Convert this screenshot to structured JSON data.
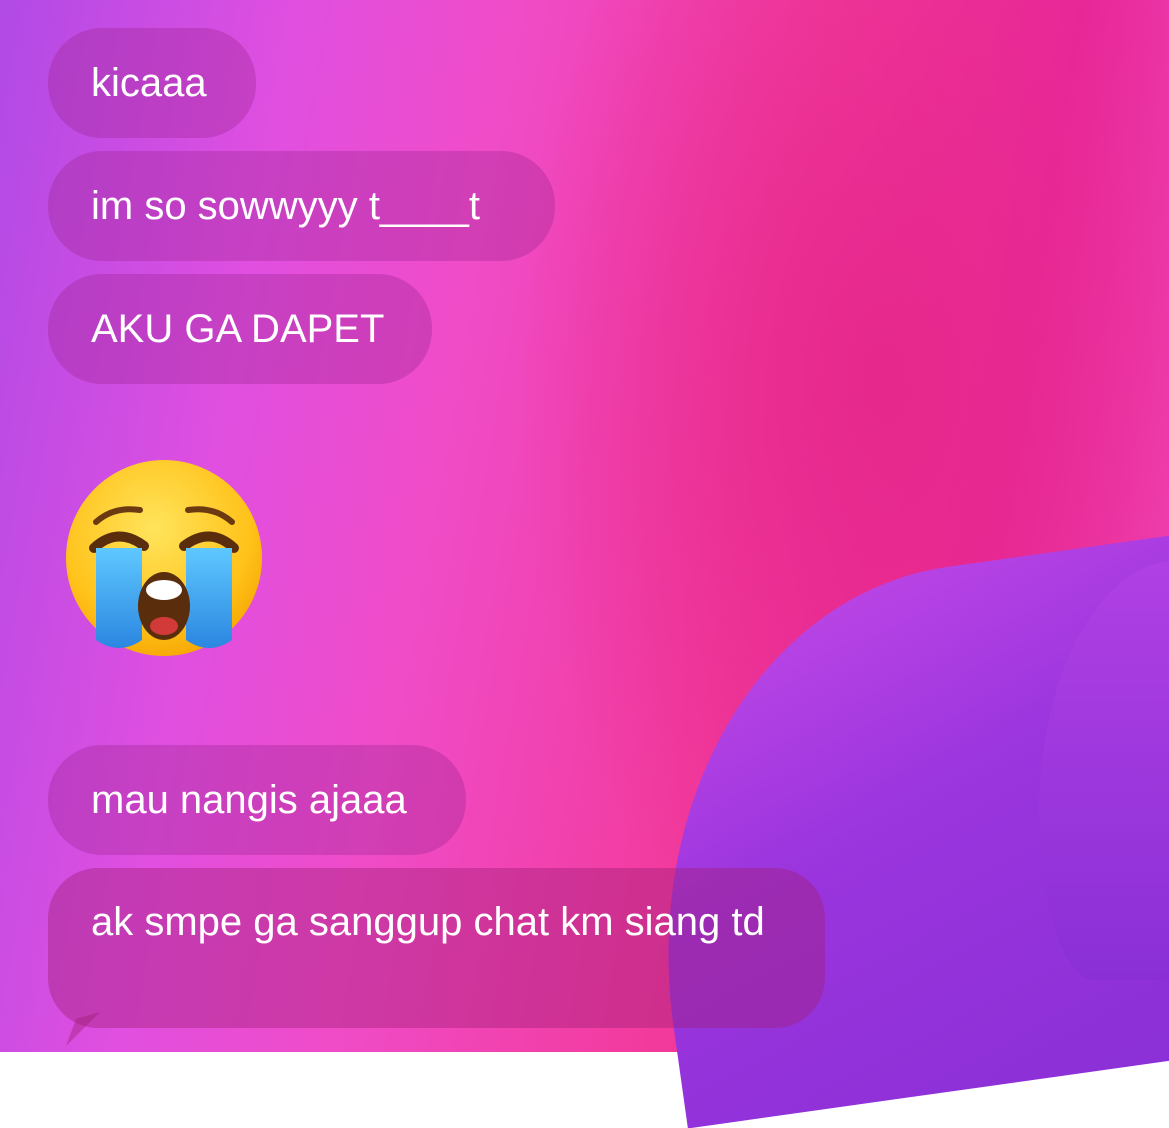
{
  "messages": [
    {
      "text": "kicaaa"
    },
    {
      "text": "im so sowwyyy t____t"
    },
    {
      "text": "AKU GA DAPET"
    },
    {
      "emoji": "loudly-crying-face"
    },
    {
      "text": "mau nangis ajaaa"
    },
    {
      "text": "ak smpe ga sanggup chat km siang td"
    }
  ],
  "colors": {
    "background_pink": "#f23a9c",
    "background_purple": "#8a2fd6",
    "bubble_text": "#ffffff"
  }
}
